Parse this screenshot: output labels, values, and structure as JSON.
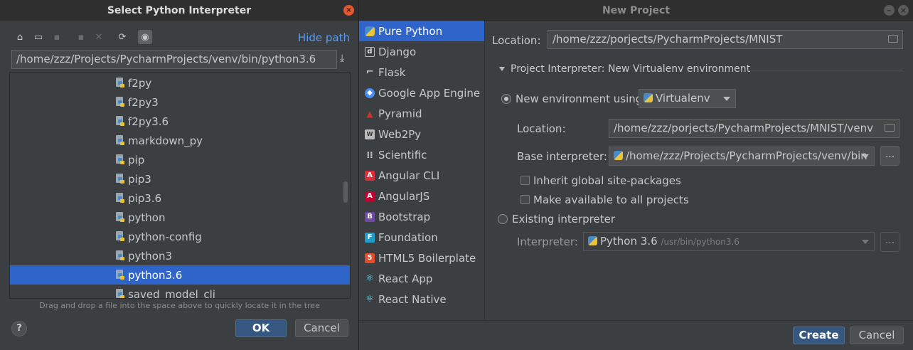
{
  "select_dialog": {
    "title": "Select Python Interpreter",
    "close_icon": "close-icon",
    "toolbar_icons": [
      "home-icon",
      "desktop-icon",
      "project-folder-icon",
      "new-folder-icon",
      "delete-icon",
      "refresh-icon",
      "show-hidden-icon"
    ],
    "hide_path_label": "Hide path",
    "path_value": "/home/zzz/Projects/PycharmProjects/venv/bin/python3.6",
    "files": [
      {
        "name": "f2py"
      },
      {
        "name": "f2py3"
      },
      {
        "name": "f2py3.6"
      },
      {
        "name": "markdown_py"
      },
      {
        "name": "pip"
      },
      {
        "name": "pip3"
      },
      {
        "name": "pip3.6"
      },
      {
        "name": "python"
      },
      {
        "name": "python-config"
      },
      {
        "name": "python3"
      },
      {
        "name": "python3.6",
        "selected": true
      },
      {
        "name": "saved_model_cli"
      }
    ],
    "hint": "Drag and drop a file into the space above to quickly locate it in the tree",
    "help_label": "?",
    "ok_label": "OK",
    "cancel_label": "Cancel"
  },
  "new_project": {
    "title": "New Project",
    "project_types": [
      {
        "label": "Pure Python",
        "icon": "python-icon",
        "selected": true
      },
      {
        "label": "Django",
        "icon": "django-icon"
      },
      {
        "label": "Flask",
        "icon": "flask-icon"
      },
      {
        "label": "Google App Engine",
        "icon": "google-app-engine-icon"
      },
      {
        "label": "Pyramid",
        "icon": "pyramid-icon"
      },
      {
        "label": "Web2Py",
        "icon": "web2py-icon"
      },
      {
        "label": "Scientific",
        "icon": "scientific-icon"
      },
      {
        "label": "Angular CLI",
        "icon": "angular-cli-icon"
      },
      {
        "label": "AngularJS",
        "icon": "angularjs-icon"
      },
      {
        "label": "Bootstrap",
        "icon": "bootstrap-icon"
      },
      {
        "label": "Foundation",
        "icon": "foundation-icon"
      },
      {
        "label": "HTML5 Boilerplate",
        "icon": "html5-icon"
      },
      {
        "label": "React App",
        "icon": "react-icon"
      },
      {
        "label": "React Native",
        "icon": "react-native-icon"
      }
    ],
    "location_label": "Location:",
    "location_value": "/home/zzz/porjects/PycharmProjects/MNIST",
    "interpreter_section": "Project Interpreter: New Virtualenv environment",
    "new_env_label": "New environment using",
    "new_env_tool": "Virtualenv",
    "venv_location_label": "Location:",
    "venv_location_value": "/home/zzz/porjects/PycharmProjects/MNIST/venv",
    "base_interpreter_label": "Base interpreter:",
    "base_interpreter_value": "/home/zzz/Projects/PycharmProjects/venv/bin",
    "more_label": "...",
    "inherit_label": "Inherit global site-packages",
    "make_available_label": "Make available to all projects",
    "existing_label": "Existing interpreter",
    "interpreter_label": "Interpreter:",
    "interpreter_name": "Python 3.6",
    "interpreter_path": "/usr/bin/python3.6",
    "create_label": "Create",
    "cancel_label": "Cancel"
  },
  "colors": {
    "accent": "#2f65ca",
    "link": "#589df6",
    "default_button": "#365880",
    "background": "#3c3f41"
  }
}
